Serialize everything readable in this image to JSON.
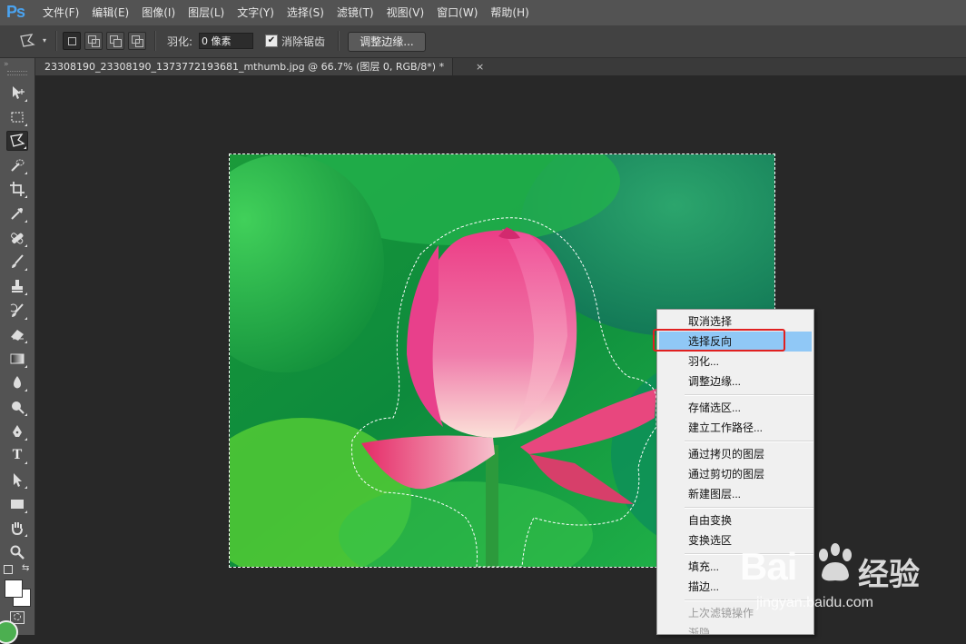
{
  "app": {
    "logo": "Ps"
  },
  "menubar": {
    "items": [
      "文件(F)",
      "编辑(E)",
      "图像(I)",
      "图层(L)",
      "文字(Y)",
      "选择(S)",
      "滤镜(T)",
      "视图(V)",
      "窗口(W)",
      "帮助(H)"
    ]
  },
  "options": {
    "feather_label": "羽化:",
    "feather_value": "0 像素",
    "antialias_label": "消除锯齿",
    "antialias_checked": true,
    "refine_edge_label": "调整边缘..."
  },
  "tools": {
    "active": "polygonal-lasso",
    "icons": [
      "move-icon",
      "marquee-icon",
      "polygonal-lasso-icon",
      "quick-select-icon",
      "crop-icon",
      "eyedropper-icon",
      "healing-brush-icon",
      "brush-icon",
      "clone-stamp-icon",
      "history-brush-icon",
      "eraser-icon",
      "gradient-icon",
      "blur-icon",
      "dodge-icon",
      "pen-icon",
      "type-icon",
      "path-select-icon",
      "rectangle-icon",
      "hand-icon",
      "zoom-icon"
    ],
    "type_glyph": "T"
  },
  "document": {
    "tab_title": "23308190_23308190_1373772193681_mthumb.jpg @ 66.7% (图层 0, RGB/8*) *",
    "close_glyph": "×"
  },
  "context_menu": {
    "items": [
      "取消选择",
      "选择反向",
      "羽化...",
      "调整边缘...",
      "存储选区...",
      "建立工作路径...",
      "通过拷贝的图层",
      "通过剪切的图层",
      "新建图层...",
      "自由变换",
      "变换选区",
      "填充...",
      "描边...",
      "上次滤镜操作",
      "渐隐"
    ],
    "highlighted": "选择反向",
    "disabled": [
      "上次滤镜操作",
      "渐隐"
    ]
  },
  "watermark": {
    "brand": "Bai",
    "brand2": "经验",
    "url": "jingyan.baidu.com"
  },
  "colors": {
    "highlight": "#90c8f6",
    "callout": "#e02020",
    "ps_blue": "#4aa3f0"
  }
}
